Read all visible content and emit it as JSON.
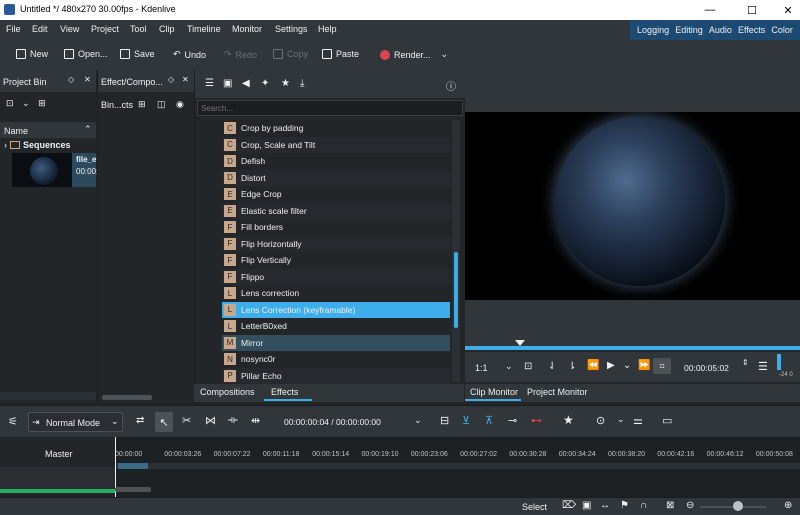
{
  "window": {
    "title": "Untitled */ 480x270 30.00fps - Kdenlive",
    "min": "—",
    "max": "☐",
    "close": "✕"
  },
  "menu": [
    "File",
    "Edit",
    "View",
    "Project",
    "Tool",
    "Clip",
    "Timeline",
    "Monitor",
    "Settings",
    "Help"
  ],
  "layouts": [
    "Logging",
    "Editing",
    "Audio",
    "Effects",
    "Color"
  ],
  "toolbar": {
    "new": "New",
    "open": "Open...",
    "save": "Save",
    "undo": "Undo",
    "redo": "Redo",
    "copy": "Copy",
    "paste": "Paste",
    "render": "Render..."
  },
  "project_bin": {
    "title": "Project Bin",
    "column": "Name",
    "folder": "Sequences",
    "clip_name": "file_e",
    "clip_time": "00:00:"
  },
  "effect_panel": {
    "title": "Effect/Compo...",
    "bin_label": "Bin...cts"
  },
  "effects_list": {
    "search_placeholder": "Search...",
    "items": [
      {
        "letter": "C",
        "name": "Crop by padding"
      },
      {
        "letter": "C",
        "name": "Crop, Scale and Tilt"
      },
      {
        "letter": "D",
        "name": "Defish"
      },
      {
        "letter": "D",
        "name": "Distort"
      },
      {
        "letter": "E",
        "name": "Edge Crop"
      },
      {
        "letter": "E",
        "name": "Elastic scale filter"
      },
      {
        "letter": "F",
        "name": "Fill borders"
      },
      {
        "letter": "F",
        "name": "Flip Horizontally"
      },
      {
        "letter": "F",
        "name": "Flip Vertically"
      },
      {
        "letter": "F",
        "name": "Flippo"
      },
      {
        "letter": "L",
        "name": "Lens correction"
      },
      {
        "letter": "L",
        "name": "Lens Correction  (keyframable)"
      },
      {
        "letter": "L",
        "name": "LetterB0xed"
      },
      {
        "letter": "M",
        "name": "Mirror"
      },
      {
        "letter": "N",
        "name": "nosync0r"
      },
      {
        "letter": "P",
        "name": "Pillar Echo"
      }
    ],
    "selected_index": 11,
    "hovered_index": 13,
    "tabs": [
      "Compositions",
      "Effects"
    ],
    "active_tab": "Effects"
  },
  "monitor": {
    "zoom": "1:1",
    "timecode": "00:00:05:02",
    "tabs": [
      "Clip Monitor",
      "Project Monitor"
    ],
    "active_tab": "Clip Monitor",
    "db": "-24 0"
  },
  "timeline": {
    "mode": "Normal Mode",
    "position": "00:00:00:04 / 00:00:00:00",
    "track": "Master",
    "ruler": [
      "00:00:00",
      "00:00:03:26",
      "00:00:07:22",
      "00:00:11:18",
      "00:00:15:14",
      "00:00:19:10",
      "00:00:23:06",
      "00:00:27:02",
      "00:00:30:28",
      "00:00:34:24",
      "00:00:38:20",
      "00:00:42:16",
      "00:00:46:12",
      "00:00:50:08"
    ]
  },
  "status": {
    "select": "Select"
  },
  "colors": {
    "accent": "#3daee9",
    "selected": "#3daee9",
    "hover": "#334e5e",
    "window": "#232629",
    "panel": "#31363b"
  }
}
